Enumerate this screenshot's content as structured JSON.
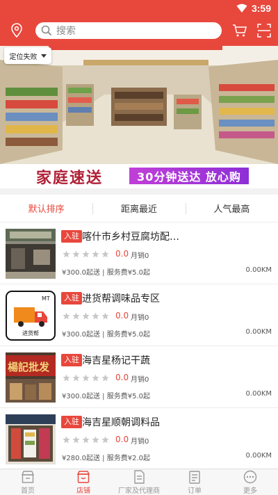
{
  "status": {
    "time": "3:59"
  },
  "header": {
    "search_placeholder": "搜索"
  },
  "location_tip": "定位失败",
  "banner": {
    "slogan": "家庭速送",
    "promo": "30分钟送达  放心购"
  },
  "sort_tabs": [
    "默认排序",
    "距离最近",
    "人气最高"
  ],
  "stores": [
    {
      "badge": "入驻",
      "name": "喀什市乡村豆腐坊配…",
      "score": "0.0",
      "sales": "月销0",
      "fee": "¥300.0起送 | 服务费¥5.0起",
      "distance": "0.00KM"
    },
    {
      "badge": "入驻",
      "name": "进货帮调味品专区",
      "score": "0.0",
      "sales": "月销0",
      "fee": "¥300.0起送 | 服务费¥5.0起",
      "distance": "0.00KM",
      "logo_tag": "MT",
      "logo_caption": "进货帮"
    },
    {
      "badge": "入驻",
      "name": "海吉星杨记干蔬",
      "score": "0.0",
      "sales": "月销0",
      "fee": "¥300.0起送 | 服务费¥5.0起",
      "distance": "0.00KM",
      "sign_text": "楊記批发"
    },
    {
      "badge": "入驻",
      "name": "海吉星顺朝调料品",
      "score": "0.0",
      "sales": "月销0",
      "fee": "¥280.0起送 | 服务费¥2.0起",
      "distance": "0.00KM"
    }
  ],
  "tabbar": [
    "首页",
    "店铺",
    "厂家及代理商",
    "订单",
    "更多"
  ],
  "colors": {
    "primary": "#e8473c",
    "text": "#222222",
    "muted": "#999999"
  }
}
